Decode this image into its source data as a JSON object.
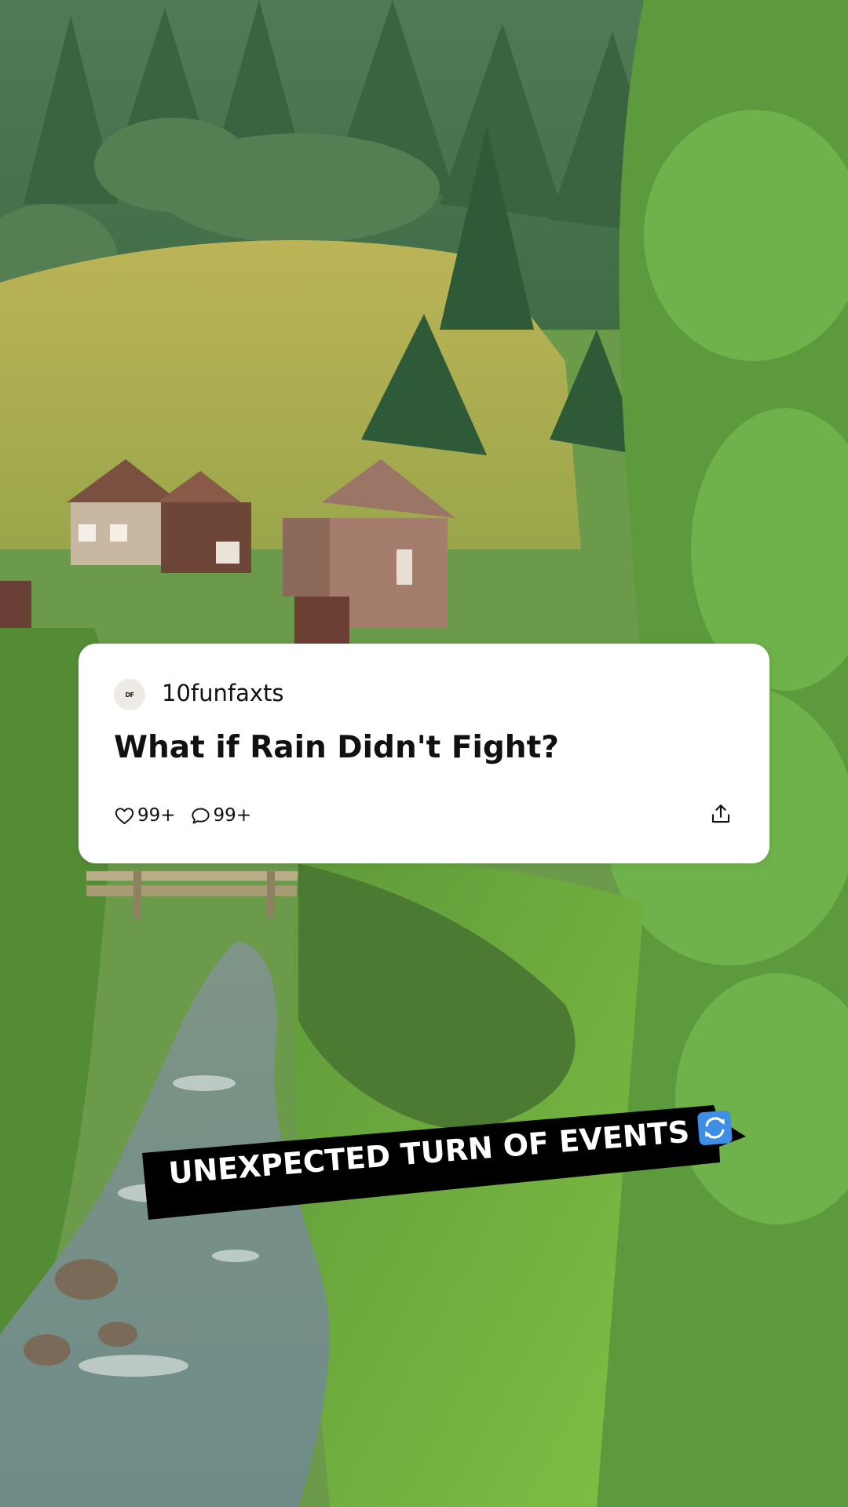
{
  "post": {
    "avatar_text": "DF",
    "username": "10funfaxts",
    "title": "What if Rain Didn't Fight?",
    "likes": "99+",
    "comments": "99+"
  },
  "banner": {
    "text": "UNEXPECTED TURN OF EVENTS",
    "emoji_icon": "counterclockwise-arrows-icon"
  },
  "icons": [
    "heart-icon",
    "comment-icon",
    "share-icon"
  ],
  "colors": {
    "card_bg": "#ffffff",
    "banner_bg": "#000000",
    "banner_text": "#ffffff",
    "emoji_bg": "#3d8fe6"
  }
}
